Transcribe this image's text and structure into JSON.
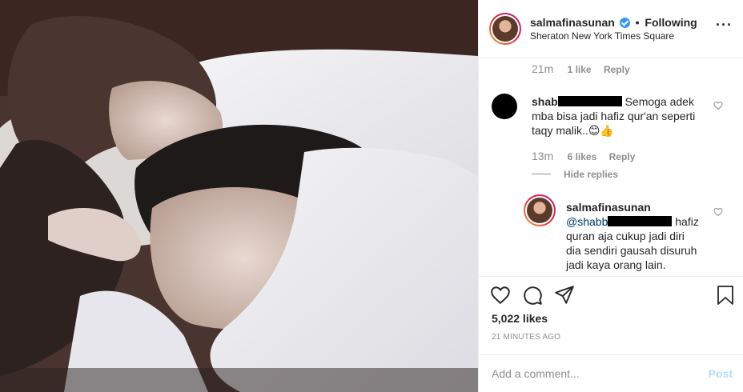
{
  "post": {
    "username": "salmafinasunan",
    "separator": "•",
    "follow_status": "Following",
    "location": "Sheraton New York Times Square",
    "more_icon": "more-options-icon"
  },
  "comments": {
    "prev": {
      "time": "21m",
      "likes": "1 like",
      "reply": "Reply"
    },
    "c1": {
      "user_prefix": "shab",
      "text_line1": "Semoga adek",
      "text_line2": "mba bisa jadi hafiz qur'an seperti",
      "text_line3": "taqy malik..",
      "emoji1": "😊",
      "emoji2": "👍",
      "time": "13m",
      "likes": "6 likes",
      "reply": "Reply",
      "hide_replies": "Hide replies"
    },
    "reply1": {
      "user": "salmafinasunan",
      "mention_prefix": "@shabb",
      "text_line1": "hafiz",
      "text_line2": "quran aja cukup jadi diri",
      "text_line3": "dia sendiri gausah disuruh",
      "text_line4": "jadi kaya orang lain."
    }
  },
  "actions": {
    "likes": "5,022 likes",
    "time_ago": "21 MINUTES AGO",
    "add_comment_placeholder": "Add a comment...",
    "post_label": "Post"
  },
  "colors": {
    "link": "#003569",
    "secondary": "#8e8e8e",
    "post_disabled": "#b2dffc",
    "verified": "#3897f0"
  }
}
